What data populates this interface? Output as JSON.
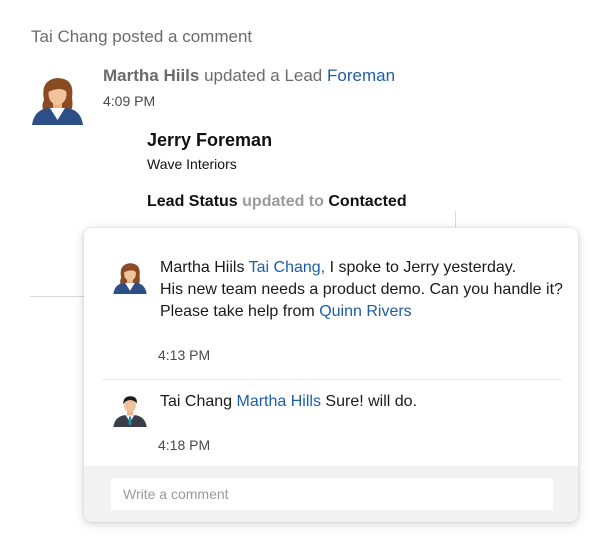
{
  "notice": "Tai Chang posted a comment",
  "post": {
    "author": "Martha Hiils",
    "action": "updated a Lead",
    "target": "Foreman",
    "time": "4:09 PM",
    "lead": {
      "name": "Jerry Foreman",
      "company": "Wave Interiors",
      "field": "Lead Status",
      "change_text": "updated to",
      "new_value": "Contacted"
    }
  },
  "comments": [
    {
      "author": "Martha Hiils",
      "mention": "Tai Chang,",
      "line1_rest": "I spoke to Jerry yesterday.",
      "line2": "His new team needs a product demo. Can you handle it?",
      "line3_prefix": "Please take help from",
      "line3_mention": "Quinn Rivers",
      "time": "4:13 PM"
    },
    {
      "author": "Tai Chang",
      "mention": "Martha Hills",
      "text": "Sure! will do.",
      "time": "4:18 PM"
    }
  ],
  "composer": {
    "placeholder": "Write a comment"
  },
  "colors": {
    "link": "#1d5ea8",
    "muted": "#6b6b6b",
    "composer_bg": "#f2f2f2"
  },
  "icons": {
    "post_avatar": "woman-avatar-icon",
    "comment1_avatar": "woman-avatar-icon",
    "comment2_avatar": "man-avatar-icon"
  }
}
